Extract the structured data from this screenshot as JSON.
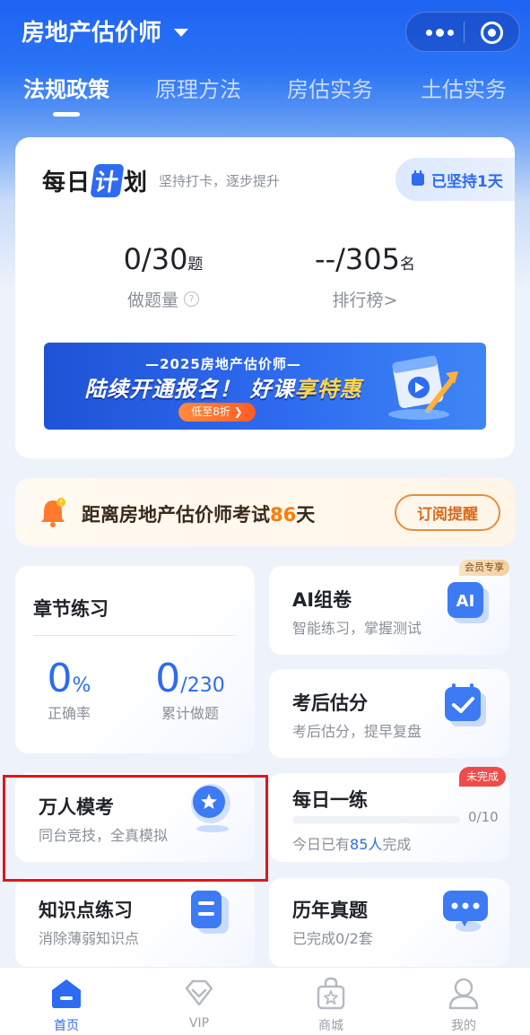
{
  "app": {
    "title": "房地产估价师"
  },
  "tabs": [
    {
      "label": "法规政策",
      "active": true
    },
    {
      "label": "原理方法",
      "active": false
    },
    {
      "label": "房估实务",
      "active": false
    },
    {
      "label": "土估实务",
      "active": false
    }
  ],
  "plan": {
    "title_pre": "每日",
    "title_hl": "计",
    "title_post": "划",
    "subtitle": "坚持打卡，逐步提升",
    "streak": "已坚持1天",
    "questions": {
      "value": "0/30",
      "unit": "题",
      "label": "做题量"
    },
    "rank": {
      "value": "--/305",
      "unit": "名",
      "label": "排行榜>"
    }
  },
  "banner": {
    "line1": "—2025房地产估价师—",
    "line2_a": "陆续开通报名！ 好课",
    "line2_b": "享特惠",
    "badge": "低至8折 ❯"
  },
  "countdown": {
    "text_pre": "距离房地产估价师考试",
    "days": "86",
    "text_post": "天",
    "button": "订阅提醒"
  },
  "chapter": {
    "title": "章节练习",
    "accuracy": {
      "value": "0",
      "unit": "%",
      "label": "正确率"
    },
    "done": {
      "value": "0",
      "unit": "/230",
      "label": "累计做题"
    }
  },
  "ai_paper": {
    "title": "AI组卷",
    "subtitle": "智能练习，掌握测试",
    "tag": "会员专享",
    "icon_text": "AI"
  },
  "estimate": {
    "title": "考后估分",
    "subtitle": "考后估分，提早复盘"
  },
  "mock": {
    "title": "万人模考",
    "subtitle": "同台竞技，全真模拟"
  },
  "daily": {
    "title": "每日一练",
    "tag": "未完成",
    "progress_label": "0/10",
    "progress": 0,
    "note_pre": "今日已有",
    "note_count": "85人",
    "note_post": "完成"
  },
  "knowledge": {
    "title": "知识点练习",
    "subtitle": "消除薄弱知识点"
  },
  "past": {
    "title": "历年真题",
    "subtitle": "已完成0/2套"
  },
  "nav": [
    {
      "label": "首页",
      "icon": "home-icon",
      "active": true
    },
    {
      "label": "VIP",
      "icon": "diamond-icon",
      "active": false
    },
    {
      "label": "商城",
      "icon": "shop-bag-icon",
      "active": false
    },
    {
      "label": "我的",
      "icon": "user-icon",
      "active": false
    }
  ],
  "colors": {
    "primary": "#2d6bf2",
    "accent_orange": "#ff7a00",
    "highlight_red": "#e0161b"
  }
}
